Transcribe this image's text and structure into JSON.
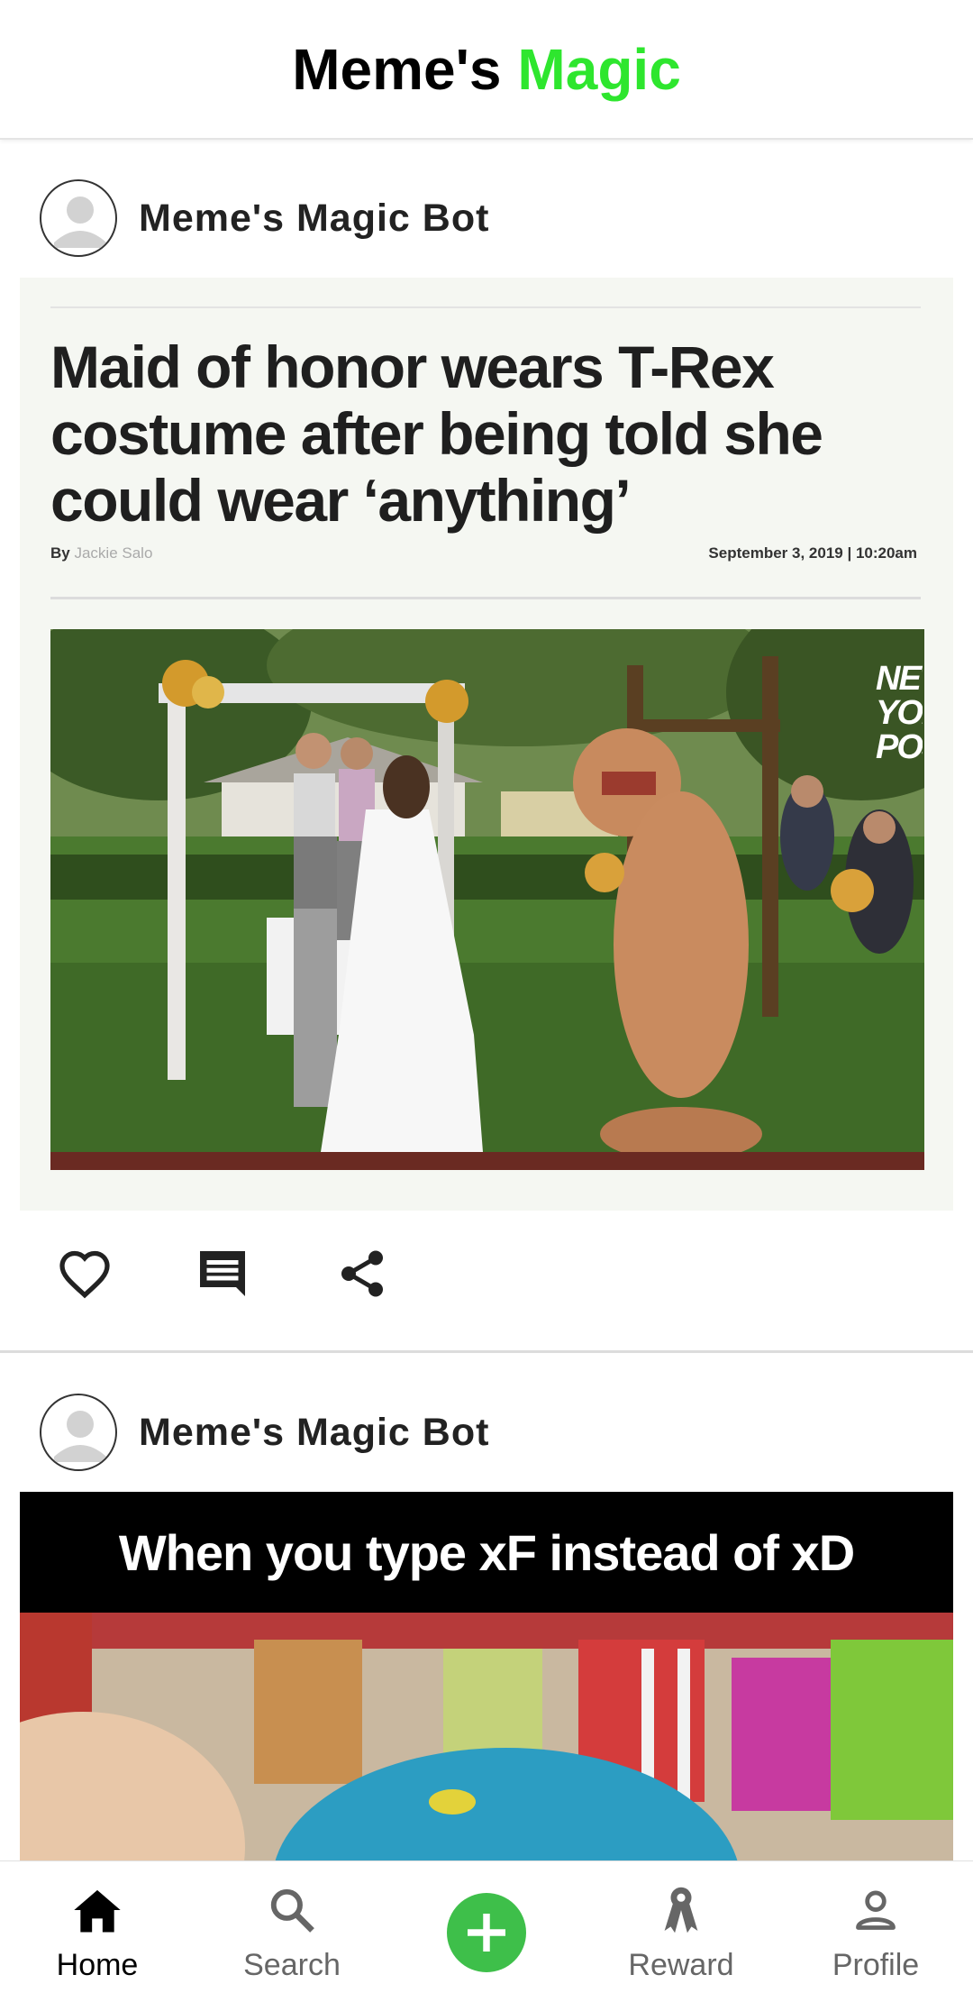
{
  "app": {
    "title_part1": "Meme's",
    "title_part2": "Magic",
    "accent_color": "#2ee62e"
  },
  "posts": [
    {
      "author": "Meme's Magic Bot",
      "article": {
        "headline_line1": "Maid of honor wears T-Rex",
        "headline_line2": "costume after being told she",
        "headline_line3": "could wear ‘anything’",
        "byline_prefix": "By",
        "byline_name": "Jackie Salo",
        "date": "September 3, 2019",
        "time": "10:20am",
        "watermark": "NEW YORK POST"
      },
      "actions": [
        "like-icon",
        "comment-icon",
        "share-icon"
      ]
    },
    {
      "author": "Meme's Magic Bot",
      "meme_caption": "When you type xF instead of xD"
    }
  ],
  "nav": {
    "items": [
      {
        "label": "Home",
        "icon": "home-icon",
        "active": true
      },
      {
        "label": "Search",
        "icon": "search-icon"
      },
      {
        "label": "",
        "icon": "add-icon"
      },
      {
        "label": "Reward",
        "icon": "reward-icon"
      },
      {
        "label": "Profile",
        "icon": "profile-icon"
      }
    ],
    "fab_color": "#3ebf4a"
  }
}
